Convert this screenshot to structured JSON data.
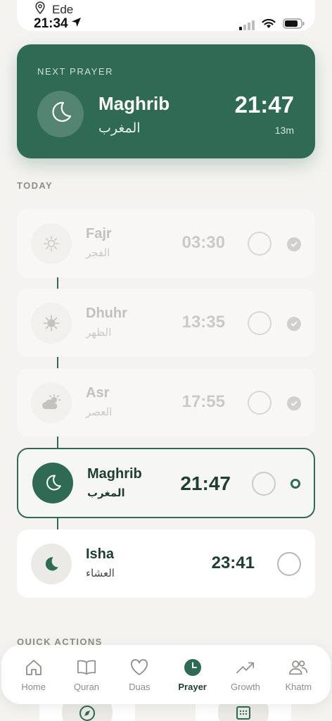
{
  "status": {
    "location": "Ede",
    "time": "21:34",
    "icons": [
      "location-pin-icon",
      "location-arrow-icon",
      "cellular-signal-icon",
      "wifi-icon",
      "battery-icon"
    ]
  },
  "next_prayer": {
    "label": "NEXT PRAYER",
    "name": "Maghrib",
    "arabic": "المغرب",
    "time": "21:47",
    "countdown": "13m",
    "icon": "moon-icon"
  },
  "today": {
    "heading": "TODAY",
    "prayers": [
      {
        "name": "Fajr",
        "arabic": "الفجر",
        "time": "03:30",
        "state": "past",
        "icon": "sun-dawn-icon"
      },
      {
        "name": "Dhuhr",
        "arabic": "الظهر",
        "time": "13:35",
        "state": "past",
        "icon": "sun-icon"
      },
      {
        "name": "Asr",
        "arabic": "العصر",
        "time": "17:55",
        "state": "past",
        "icon": "cloud-sun-icon"
      },
      {
        "name": "Maghrib",
        "arabic": "المغرب",
        "time": "21:47",
        "state": "current",
        "icon": "moon-icon"
      },
      {
        "name": "Isha",
        "arabic": "العشاء",
        "time": "23:41",
        "state": "upcoming",
        "icon": "moon-filled-icon"
      }
    ]
  },
  "quick_actions": {
    "heading": "QUICK ACTIONS"
  },
  "nav": {
    "items": [
      {
        "label": "Home",
        "icon": "home-icon",
        "active": false
      },
      {
        "label": "Quran",
        "icon": "book-icon",
        "active": false
      },
      {
        "label": "Duas",
        "icon": "heart-icon",
        "active": false
      },
      {
        "label": "Prayer",
        "icon": "clock-icon",
        "active": true
      },
      {
        "label": "Growth",
        "icon": "trend-up-icon",
        "active": false
      },
      {
        "label": "Khatm",
        "icon": "people-icon",
        "active": false
      }
    ]
  },
  "colors": {
    "accent": "#2f6a54",
    "background": "#f4f3f0"
  }
}
